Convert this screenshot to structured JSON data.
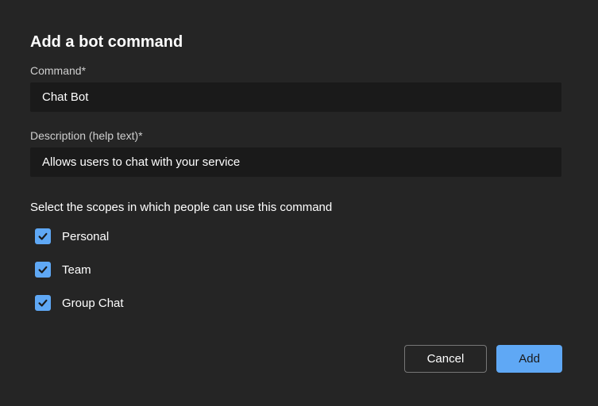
{
  "title": "Add a bot command",
  "fields": {
    "command": {
      "label": "Command",
      "required": "*",
      "value": "Chat Bot"
    },
    "description": {
      "label": "Description (help text)",
      "required": "*",
      "value": "Allows users to chat with your service"
    }
  },
  "scopes": {
    "label": "Select the scopes in which people can use this command",
    "items": [
      {
        "label": "Personal",
        "checked": true
      },
      {
        "label": "Team",
        "checked": true
      },
      {
        "label": "Group Chat",
        "checked": true
      }
    ]
  },
  "buttons": {
    "cancel": "Cancel",
    "add": "Add"
  }
}
